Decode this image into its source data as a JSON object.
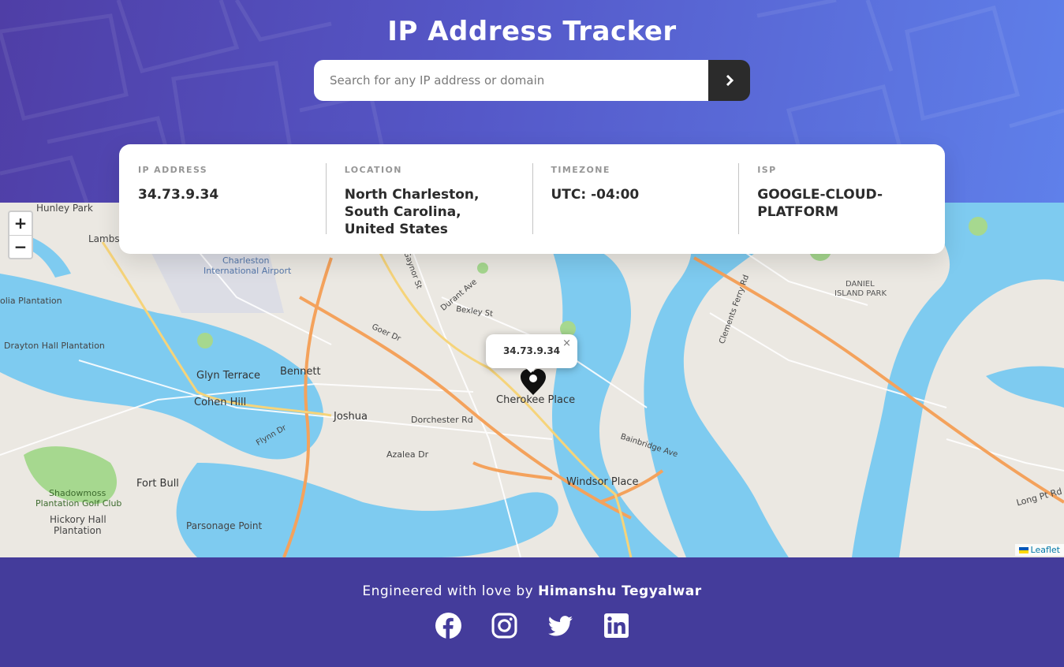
{
  "header": {
    "title": "IP Address Tracker"
  },
  "search": {
    "placeholder": "Search for any IP address or domain",
    "value": ""
  },
  "info": {
    "ip_label": "IP ADDRESS",
    "ip_value": "34.73.9.34",
    "location_label": "LOCATION",
    "location_value": "North Charleston, South Carolina, United States",
    "timezone_label": "TIMEZONE",
    "timezone_value": "UTC: -04:00",
    "isp_label": "ISP",
    "isp_value": "GOOGLE-CLOUD-PLATFORM"
  },
  "map": {
    "zoom_in": "+",
    "zoom_out": "−",
    "popup_text": "34.73.9.34",
    "popup_close": "×",
    "attribution": "Leaflet",
    "labels": {
      "hunley_park": "Hunley Park",
      "lambs": "Lambs",
      "airport_1": "Charleston",
      "airport_2": "International Airport",
      "plantation": "olia Plantation",
      "drayton": "Drayton Hall Plantation",
      "glyn": "Glyn Terrace",
      "bennett": "Bennett",
      "cohen": "Cohen Hill",
      "joshua": "Joshua",
      "fort_bull": "Fort Bull",
      "shadowmoss_1": "Shadowmoss",
      "shadowmoss_2": "Plantation Golf Club",
      "hickory_1": "Hickory Hall",
      "hickory_2": "Plantation",
      "parsonage": "Parsonage Point",
      "cherokee": "Cherokee Place",
      "windsor": "Windsor Place",
      "dorchester": "Dorchester Rd",
      "azalea": "Azalea Dr",
      "bainbridge": "Bainbridge Ave",
      "flynn": "Flynn Dr",
      "goer": "Goer Dr",
      "durant": "Durant Ave",
      "bexley": "Bexley St",
      "gaynor": "Gaynor St",
      "clements": "Clements Ferry Rd",
      "daniel_1": "DANIEL",
      "daniel_2": "ISLAND PARK",
      "long_pt": "Long Pt Rd"
    }
  },
  "footer": {
    "credit_prefix": "Engineered with love by ",
    "credit_name": "Himanshu Tegyalwar"
  },
  "socials": [
    "facebook",
    "instagram",
    "twitter",
    "linkedin"
  ]
}
